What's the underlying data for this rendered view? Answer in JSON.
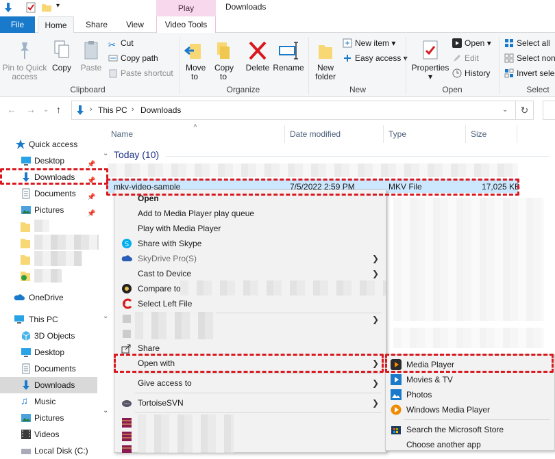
{
  "title_bar": {
    "context_tab": "Play",
    "window_title": "Downloads"
  },
  "tabs": [
    "File",
    "Home",
    "Share",
    "View",
    "Video Tools"
  ],
  "ribbon": {
    "clipboard": {
      "pin": "Pin to Quick access",
      "copy": "Copy",
      "paste": "Paste",
      "cut": "Cut",
      "copy_path": "Copy path",
      "paste_shortcut": "Paste shortcut",
      "label": "Clipboard"
    },
    "organize": {
      "move_to": "Move to",
      "copy_to": "Copy to",
      "delete": "Delete",
      "rename": "Rename",
      "label": "Organize"
    },
    "new": {
      "new_folder": "New folder",
      "new_item": "New item",
      "easy_access": "Easy access",
      "label": "New"
    },
    "open": {
      "properties": "Properties",
      "open": "Open",
      "edit": "Edit",
      "history": "History",
      "label": "Open"
    },
    "select": {
      "select_all": "Select all",
      "select_none": "Select non",
      "invert": "Invert selec",
      "label": "Select"
    }
  },
  "address": {
    "crumbs": [
      "This PC",
      "Downloads"
    ]
  },
  "nav": {
    "quick_access": "Quick access",
    "qa_items": [
      "Desktop",
      "Downloads",
      "Documents",
      "Pictures"
    ],
    "onedrive": "OneDrive",
    "this_pc": "This PC",
    "pc_items": [
      "3D Objects",
      "Desktop",
      "Documents",
      "Downloads",
      "Music",
      "Pictures",
      "Videos",
      "Local Disk (C:)"
    ]
  },
  "filelist": {
    "columns": [
      "Name",
      "Date modified",
      "Type",
      "Size"
    ],
    "group": "Today (10)",
    "selected_file": {
      "name": "mkv-video-sample",
      "date": "7/5/2022 2:59 PM",
      "type": "MKV File",
      "size": "17,025 KB"
    }
  },
  "context_menu": {
    "items": [
      {
        "label": "Open",
        "icon": "",
        "bold": true,
        "arrow": false,
        "disabled": false
      },
      {
        "label": "Add to Media Player play queue",
        "icon": "",
        "bold": false,
        "arrow": false,
        "disabled": false
      },
      {
        "label": "Play with Media Player",
        "icon": "",
        "bold": false,
        "arrow": false,
        "disabled": false
      },
      {
        "label": "Share with Skype",
        "icon": "skype-icon",
        "bold": false,
        "arrow": false,
        "disabled": false
      },
      {
        "label": "SkyDrive Pro(S)",
        "icon": "skydrive-icon",
        "bold": false,
        "arrow": true,
        "disabled": true
      },
      {
        "label": "Cast to Device",
        "icon": "",
        "bold": false,
        "arrow": true,
        "disabled": false
      },
      {
        "label": "Compare to",
        "icon": "compare-icon",
        "bold": false,
        "arrow": false,
        "disabled": false
      },
      {
        "label": "Select Left File",
        "icon": "select-left-icon",
        "bold": false,
        "arrow": false,
        "disabled": false
      }
    ],
    "share": "Share",
    "open_with": "Open with",
    "give_access": "Give access to",
    "tortoise": "TortoiseSVN"
  },
  "open_with_submenu": {
    "apps": [
      "Media Player",
      "Movies & TV",
      "Photos",
      "Windows Media Player"
    ],
    "store": "Search the Microsoft Store",
    "another": "Choose another app"
  },
  "colors": {
    "accent": "#1979ca",
    "highlight": "#d9181e",
    "selection": "#cce8ff",
    "context_tab": "#f8d8ec"
  }
}
